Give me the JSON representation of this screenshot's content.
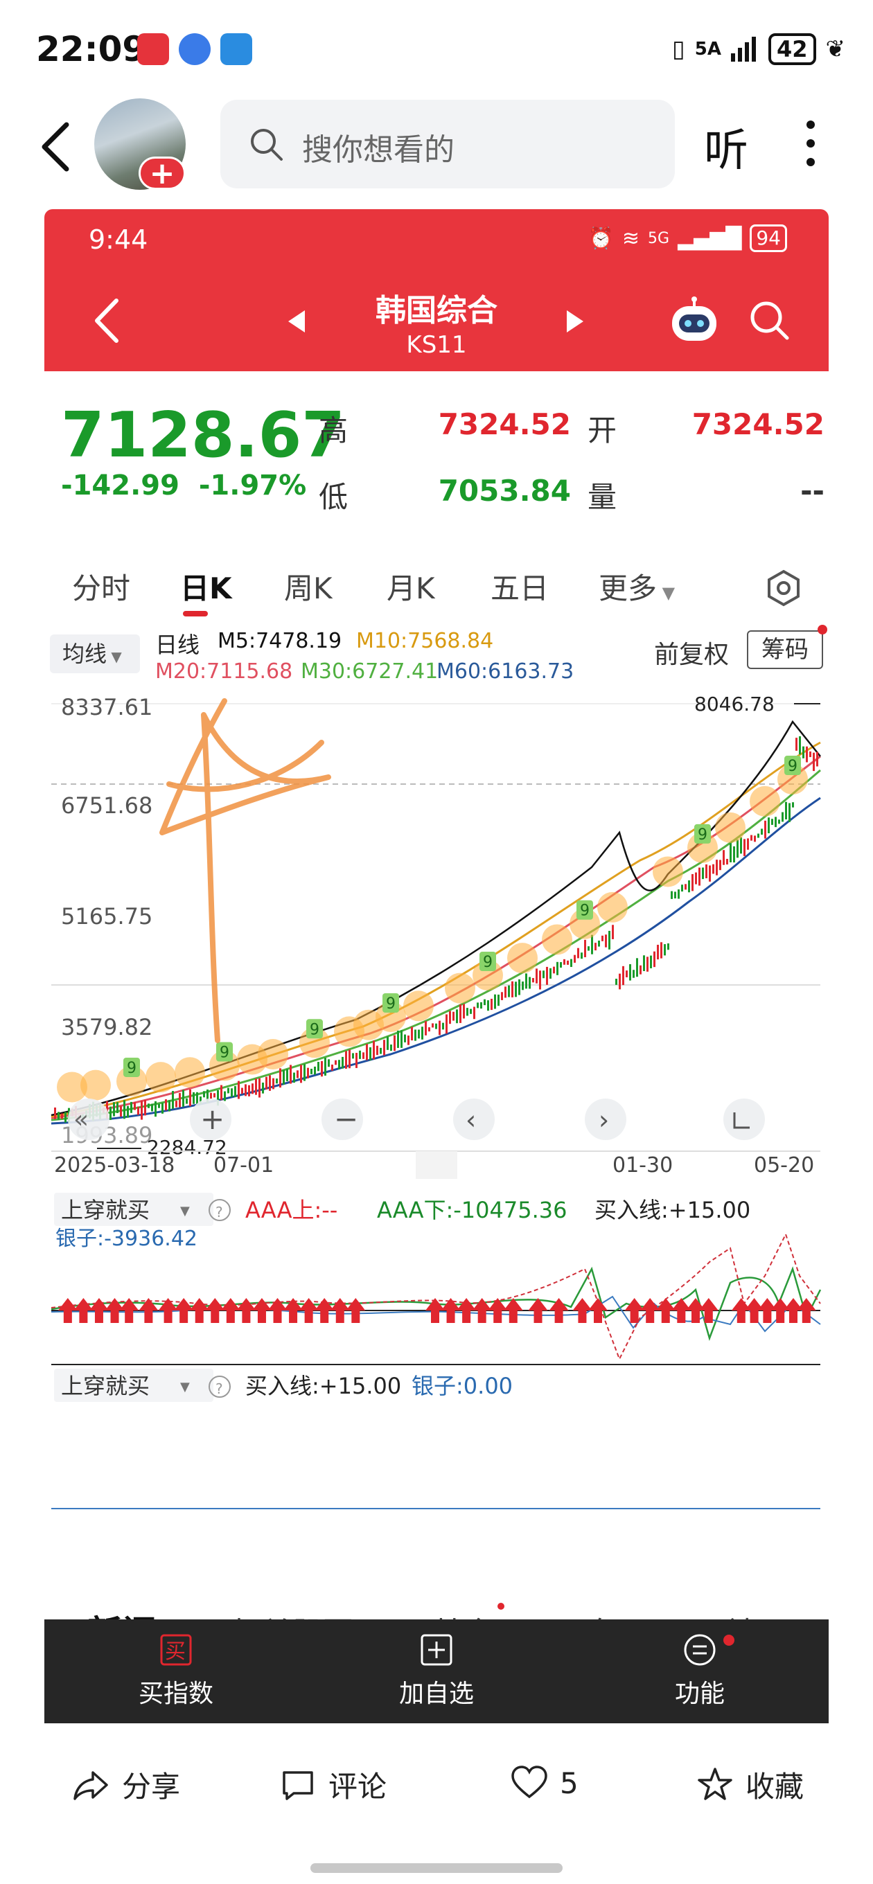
{
  "status_bar": {
    "time": "22:09",
    "network": "5A",
    "battery": "42"
  },
  "header": {
    "search_placeholder": "搜你想看的",
    "listen_label": "听"
  },
  "inner_status": {
    "time": "9:44",
    "network": "5G",
    "battery": "94"
  },
  "stock": {
    "name": "韩国综合",
    "code": "KS11",
    "price": "7128.67",
    "change": "-142.99",
    "change_pct": "-1.97%",
    "high_label": "高",
    "high": "7324.52",
    "low_label": "低",
    "low": "7053.84",
    "open_label": "开",
    "open": "7324.52",
    "volume_label": "量",
    "volume": "--"
  },
  "tabs": [
    {
      "label": "分时"
    },
    {
      "label": "日K"
    },
    {
      "label": "周K"
    },
    {
      "label": "月K"
    },
    {
      "label": "五日"
    },
    {
      "label": "更多"
    }
  ],
  "ma": {
    "button": "均线",
    "kind": "日线",
    "m5": "M5:7478.19",
    "m10": "M10:7568.84",
    "m20": "M20:7115.68",
    "m30": "M30:6727.41",
    "m60": "M60:6163.73",
    "adjust": "前复权",
    "chips": "筹码"
  },
  "chart_data": {
    "type": "candlestick",
    "y_ticks": [
      "8337.61",
      "6751.68",
      "5165.75",
      "3579.82",
      "1993.89"
    ],
    "x_ticks": [
      "2025-03-18",
      "07-01",
      "01-30",
      "05-20"
    ],
    "max_label": "8046.78",
    "min_label": "2284.72",
    "signal_marker": "9",
    "ma_colors": {
      "m5": "#111111",
      "m10": "#e0a020",
      "m20": "#e05060",
      "m30": "#50b040",
      "m60": "#2050a0"
    }
  },
  "indicator1": {
    "name": "上穿就买",
    "aaa_up": "AAA上:--",
    "aaa_down": "AAA下:-10475.36",
    "buy_line": "买入线:+15.00",
    "silver": "银子:-3936.42"
  },
  "indicator2": {
    "name": "上穿就买",
    "buy_line": "买入线:+15.00",
    "silver": "银子:0.00"
  },
  "bottom_tabs": [
    {
      "label": "新闻"
    },
    {
      "label": "相关股票"
    },
    {
      "label": "基金"
    },
    {
      "label": "盘口"
    },
    {
      "label": "社区"
    }
  ],
  "dark_bar": {
    "buy": "买指数",
    "buy_icon_text": "买",
    "add": "加自选",
    "func": "功能"
  },
  "actions": {
    "share": "分享",
    "comment": "评论",
    "likes": "5",
    "favorite": "收藏"
  }
}
